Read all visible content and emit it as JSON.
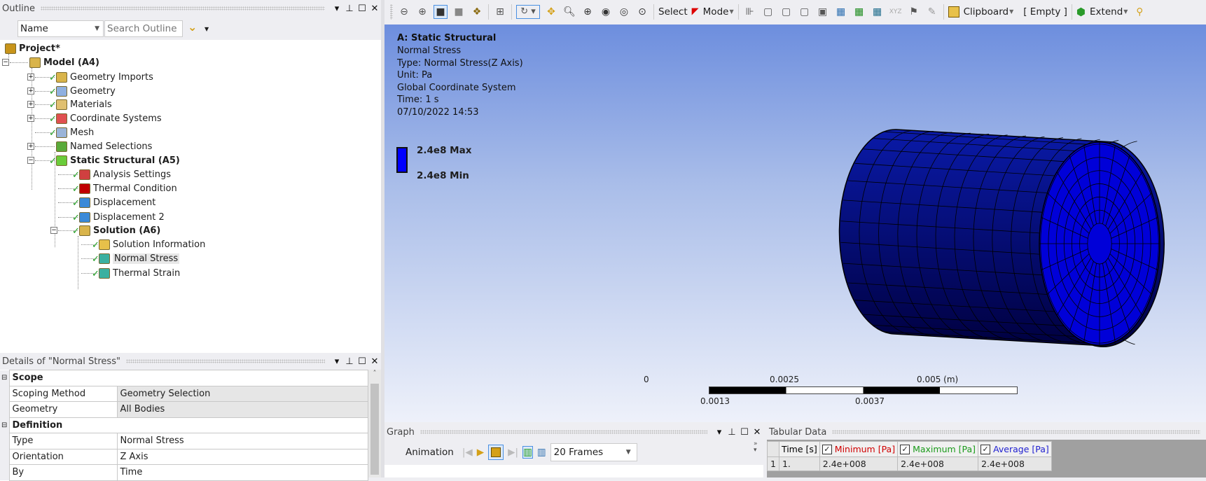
{
  "outline": {
    "title": "Outline",
    "filter_select": "Name",
    "search_placeholder": "Search Outline",
    "tree": [
      {
        "label": "Project*",
        "bold": true
      },
      {
        "label": "Model (A4)",
        "bold": true
      },
      {
        "label": "Geometry Imports"
      },
      {
        "label": "Geometry"
      },
      {
        "label": "Materials"
      },
      {
        "label": "Coordinate Systems"
      },
      {
        "label": "Mesh"
      },
      {
        "label": "Named Selections"
      },
      {
        "label": "Static Structural (A5)",
        "bold": true
      },
      {
        "label": "Analysis Settings"
      },
      {
        "label": "Thermal Condition"
      },
      {
        "label": "Displacement"
      },
      {
        "label": "Displacement 2"
      },
      {
        "label": "Solution (A6)",
        "bold": true
      },
      {
        "label": "Solution Information"
      },
      {
        "label": "Normal Stress",
        "selected": true
      },
      {
        "label": "Thermal Strain"
      }
    ]
  },
  "details": {
    "title": "Details of \"Normal Stress\"",
    "sections": [
      {
        "name": "Scope",
        "rows": [
          [
            "Scoping Method",
            "Geometry Selection"
          ],
          [
            "Geometry",
            "All Bodies"
          ]
        ]
      },
      {
        "name": "Definition",
        "rows": [
          [
            "Type",
            "Normal Stress"
          ],
          [
            "Orientation",
            "Z Axis"
          ],
          [
            "By",
            "Time"
          ]
        ]
      }
    ]
  },
  "toolbar": {
    "select": "Select",
    "mode": "Mode",
    "clipboard": "Clipboard",
    "empty": "[ Empty ]",
    "extend": "Extend"
  },
  "viewport": {
    "title": "A: Static Structural",
    "lines": [
      "Normal Stress",
      "Type: Normal Stress(Z Axis)",
      "Unit: Pa",
      "Global Coordinate System",
      "Time: 1 s",
      "07/10/2022 14:53"
    ],
    "legend_max": "2.4e8 Max",
    "legend_min": "2.4e8 Min",
    "legend_color": "#0000ff",
    "scale": {
      "top": [
        "0",
        "0.0025",
        "0.005 (m)"
      ],
      "bottom": [
        "0.0013",
        "0.0037"
      ]
    }
  },
  "graph": {
    "title": "Graph",
    "animation": "Animation",
    "frames": "20 Frames"
  },
  "tabular": {
    "title": "Tabular Data",
    "headers": [
      "Time [s]",
      "Minimum [Pa]",
      "Maximum [Pa]",
      "Average [Pa]"
    ],
    "header_colors": [
      "#000000",
      "#d00000",
      "#1a9a1a",
      "#2020d0"
    ],
    "rows": [
      [
        "1",
        "1.",
        "2.4e+008",
        "2.4e+008",
        "2.4e+008"
      ]
    ]
  }
}
